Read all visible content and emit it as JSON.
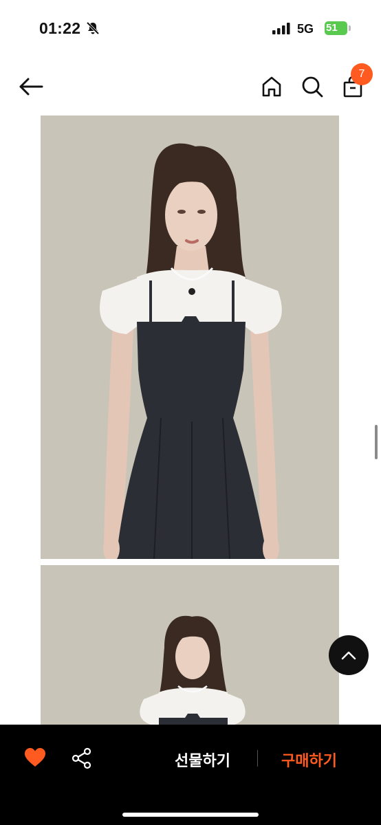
{
  "status_bar": {
    "time": "01:22",
    "network": "5G",
    "battery": "51"
  },
  "nav": {
    "cart_count": "7"
  },
  "bottom_bar": {
    "gift_label": "선물하기",
    "buy_label": "구매하기"
  },
  "colors": {
    "accent": "#ff5a1f",
    "bar": "#000000",
    "battery": "#5ac94f"
  },
  "icons": [
    "bell-slash-icon",
    "signal-icon",
    "battery-icon",
    "back-arrow-icon",
    "home-icon",
    "search-icon",
    "shopping-bag-icon",
    "chevron-up-icon",
    "heart-icon",
    "share-icon"
  ]
}
